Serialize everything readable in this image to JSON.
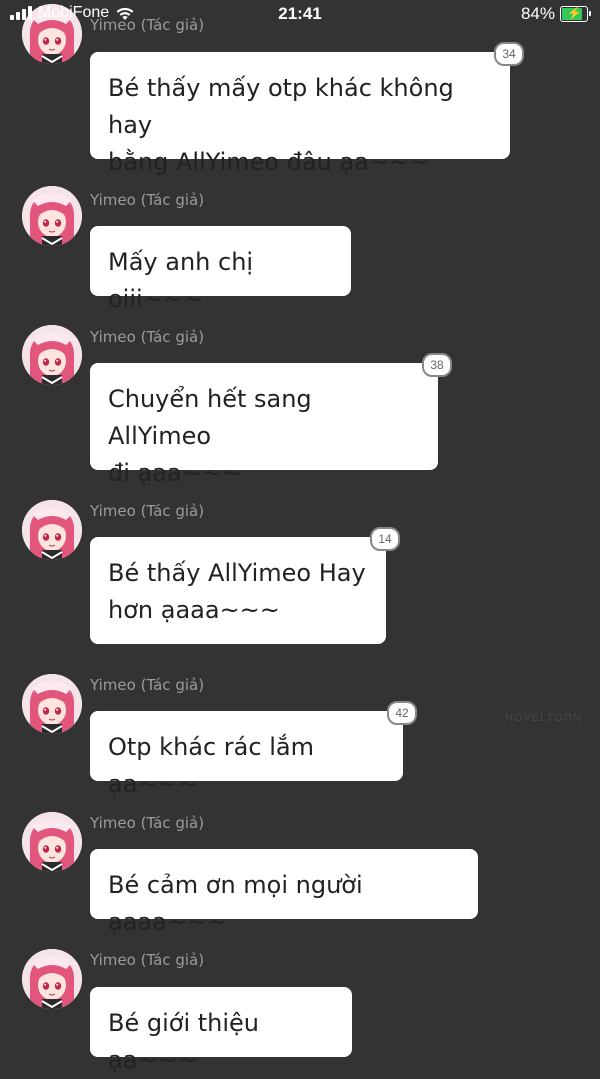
{
  "status_bar": {
    "carrier": "MobiFone",
    "time": "21:41",
    "battery_percent": "84%",
    "battery_level": 0.84,
    "icons": [
      "signal-icon",
      "wifi-icon",
      "battery-icon",
      "charging-bolt-icon"
    ]
  },
  "colors": {
    "background": "#333333",
    "bubble": "#ffffff",
    "bubble_text": "#222222",
    "author_text": "#9b9b9b",
    "battery_fill": "#35c759"
  },
  "messages": [
    {
      "author": "Yimeo (Tác giả)",
      "text": "Bé thấy mấy otp khác không hay\nbằng AllYimeo đâu ạa~~~",
      "badge": "34"
    },
    {
      "author": "Yimeo (Tác giả)",
      "text": "Mấy anh chị oiii~~~",
      "badge": ""
    },
    {
      "author": "Yimeo (Tác giả)",
      "text": "Chuyển hết sang AllYimeo\nđi ạaa~~~",
      "badge": "38"
    },
    {
      "author": "Yimeo (Tác giả)",
      "text": "Bé thấy AllYimeo Hay\nhơn ạaaa~~~",
      "badge": "14"
    },
    {
      "author": "Yimeo (Tác giả)",
      "text": "Otp khác rác lắm ạa~~~",
      "badge": "42"
    },
    {
      "author": "Yimeo (Tác giả)",
      "text": "Bé cảm ơn mọi người ạaaa~~~",
      "badge": ""
    },
    {
      "author": "Yimeo (Tác giả)",
      "text": "Bé giới thiệu ạa~~~",
      "badge": ""
    }
  ],
  "watermark": "NOVELTOON"
}
